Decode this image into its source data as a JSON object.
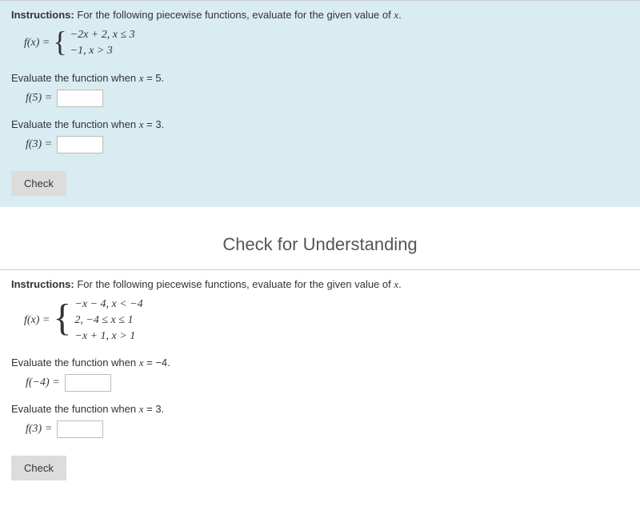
{
  "section1": {
    "instructions_label": "Instructions:",
    "instructions_text": " For the following piecewise functions, evaluate for the given value of ",
    "var": "x",
    "func_lhs": "f(x) = ",
    "cases": [
      "−2x + 2,  x ≤ 3",
      "−1,  x > 3"
    ],
    "prompts": [
      {
        "text_prefix": "Evaluate the function when ",
        "var": "x",
        "eq": " = 5.",
        "label": "f(5) = "
      },
      {
        "text_prefix": "Evaluate the function when ",
        "var": "x",
        "eq": " = 3.",
        "label": "f(3) = "
      }
    ],
    "check_label": "Check"
  },
  "mid_title": "Check for Understanding",
  "section2": {
    "instructions_label": "Instructions:",
    "instructions_text": " For the following piecewise functions, evaluate for the given value of ",
    "var": "x",
    "func_lhs": "f(x) = ",
    "cases": [
      "−x − 4,  x < −4",
      "2,  −4 ≤ x ≤ 1",
      "−x + 1,  x > 1"
    ],
    "prompts": [
      {
        "text_prefix": "Evaluate the function when ",
        "var": "x",
        "eq": " = −4.",
        "label": "f(−4) = "
      },
      {
        "text_prefix": "Evaluate the function when ",
        "var": "x",
        "eq": " = 3.",
        "label": "f(3) = "
      }
    ],
    "check_label": "Check"
  }
}
